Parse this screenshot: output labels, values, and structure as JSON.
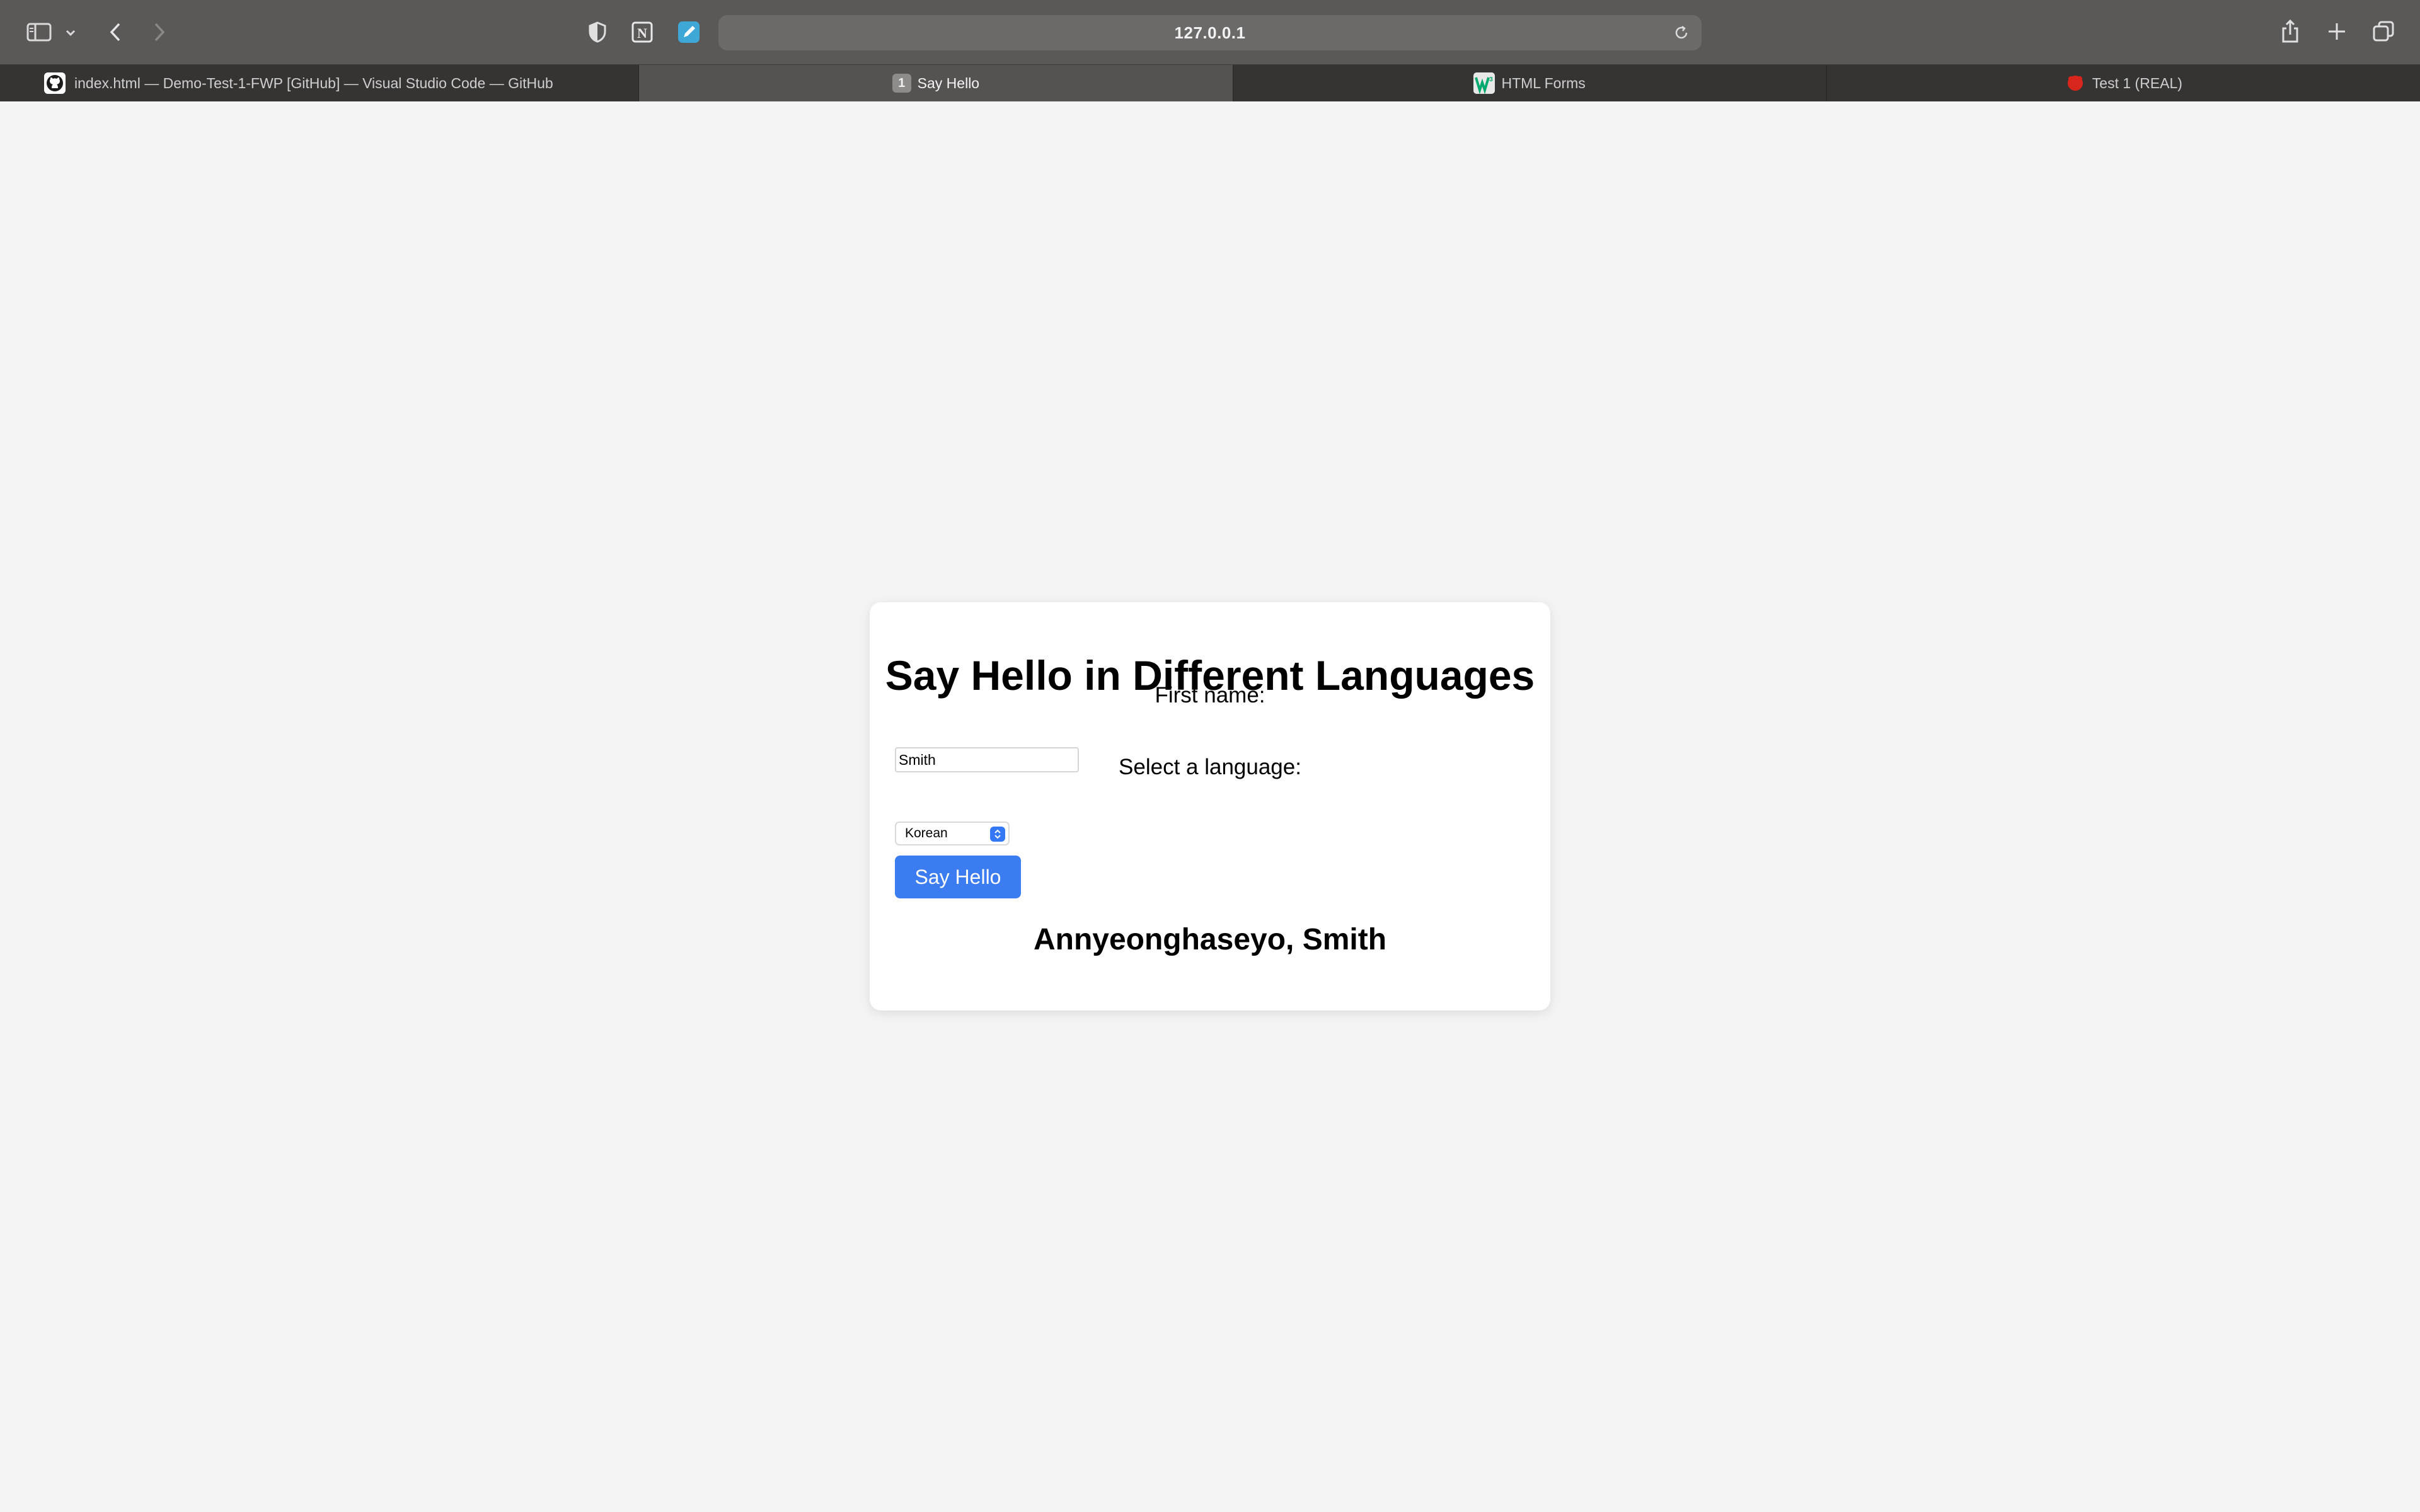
{
  "browser": {
    "url": "127.0.0.1",
    "tabs": [
      {
        "title": "index.html — Demo-Test-1-FWP [GitHub] — Visual Studio Code — GitHub",
        "favicon": "github-icon",
        "active": false
      },
      {
        "title": "Say Hello",
        "favicon": "numbered-badge-icon",
        "badge": "1",
        "active": true
      },
      {
        "title": "HTML Forms",
        "favicon": "w3schools-icon",
        "active": false
      },
      {
        "title": "Test 1 (REAL)",
        "favicon": "red-app-icon",
        "active": false
      }
    ]
  },
  "page": {
    "heading": "Say Hello in Different Languages",
    "first_name_label": "First name:",
    "first_name_value": "Smith",
    "language_label": "Select a language:",
    "language_selected": "Korean",
    "submit_label": "Say Hello",
    "greeting": "Annyeonghaseyo, Smith"
  },
  "colors": {
    "toolbar": "#5a5958",
    "tabstrip": "#353433",
    "page_bg": "#f4f4f4",
    "button_blue": "#3b7cf0"
  }
}
